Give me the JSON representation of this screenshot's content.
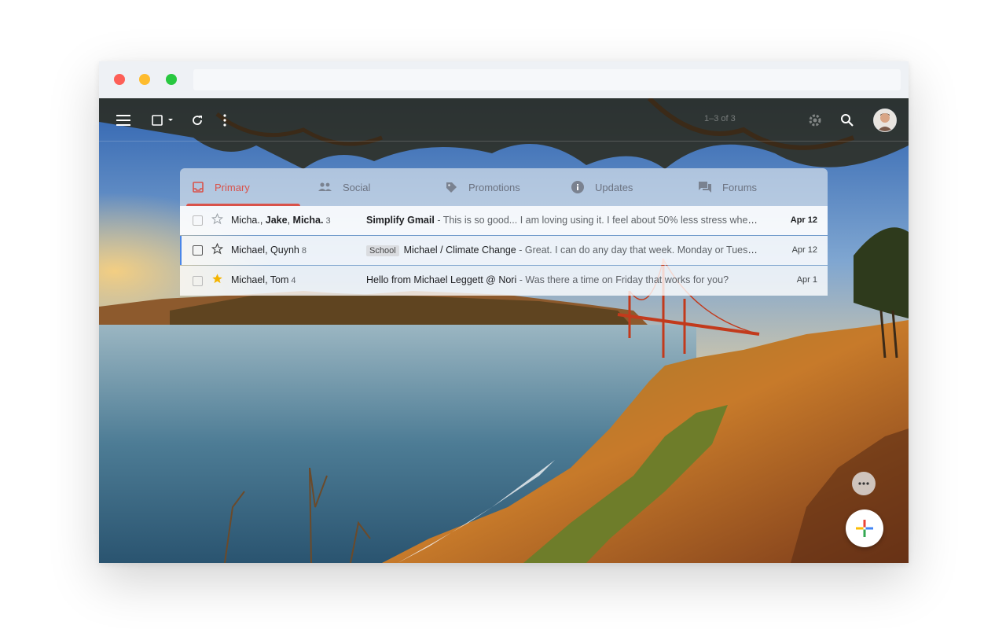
{
  "toolbar": {
    "pagination": "1–3 of 3"
  },
  "tabs": [
    {
      "label": "Primary",
      "icon": "inbox-icon",
      "active": true,
      "color": "#d9524a"
    },
    {
      "label": "Social",
      "icon": "people-icon",
      "active": false
    },
    {
      "label": "Promotions",
      "icon": "tag-icon",
      "active": false
    },
    {
      "label": "Updates",
      "icon": "info-icon",
      "active": false
    },
    {
      "label": "Forums",
      "icon": "forum-icon",
      "active": false
    }
  ],
  "emails": [
    {
      "sender_parts": [
        "Micha., ",
        "Jake",
        ", ",
        "Micha."
      ],
      "count": "3",
      "subject": "Simplify Gmail",
      "snippet": " - This is so good... I am loving using it. I feel about 50% less stress when …",
      "date": "Apr 12",
      "starred": false,
      "unread": true
    },
    {
      "sender": "Michael, Quynh",
      "count": "8",
      "label": "School",
      "subject": "Michael / Climate Change",
      "snippet": " - Great. I can do any day that week. Monday or Tuesd…",
      "date": "Apr 12",
      "starred": false,
      "unread": false
    },
    {
      "sender": "Michael, Tom",
      "count": "4",
      "subject": "Hello from Michael Leggett @ Nori",
      "snippet": " - Was there a time on Friday that works for you?",
      "date": "Apr 1",
      "starred": true,
      "unread": false
    }
  ],
  "colors": {
    "accent": "#d9524a",
    "star": "#f4b400",
    "selected_border": "#4a86e8"
  }
}
